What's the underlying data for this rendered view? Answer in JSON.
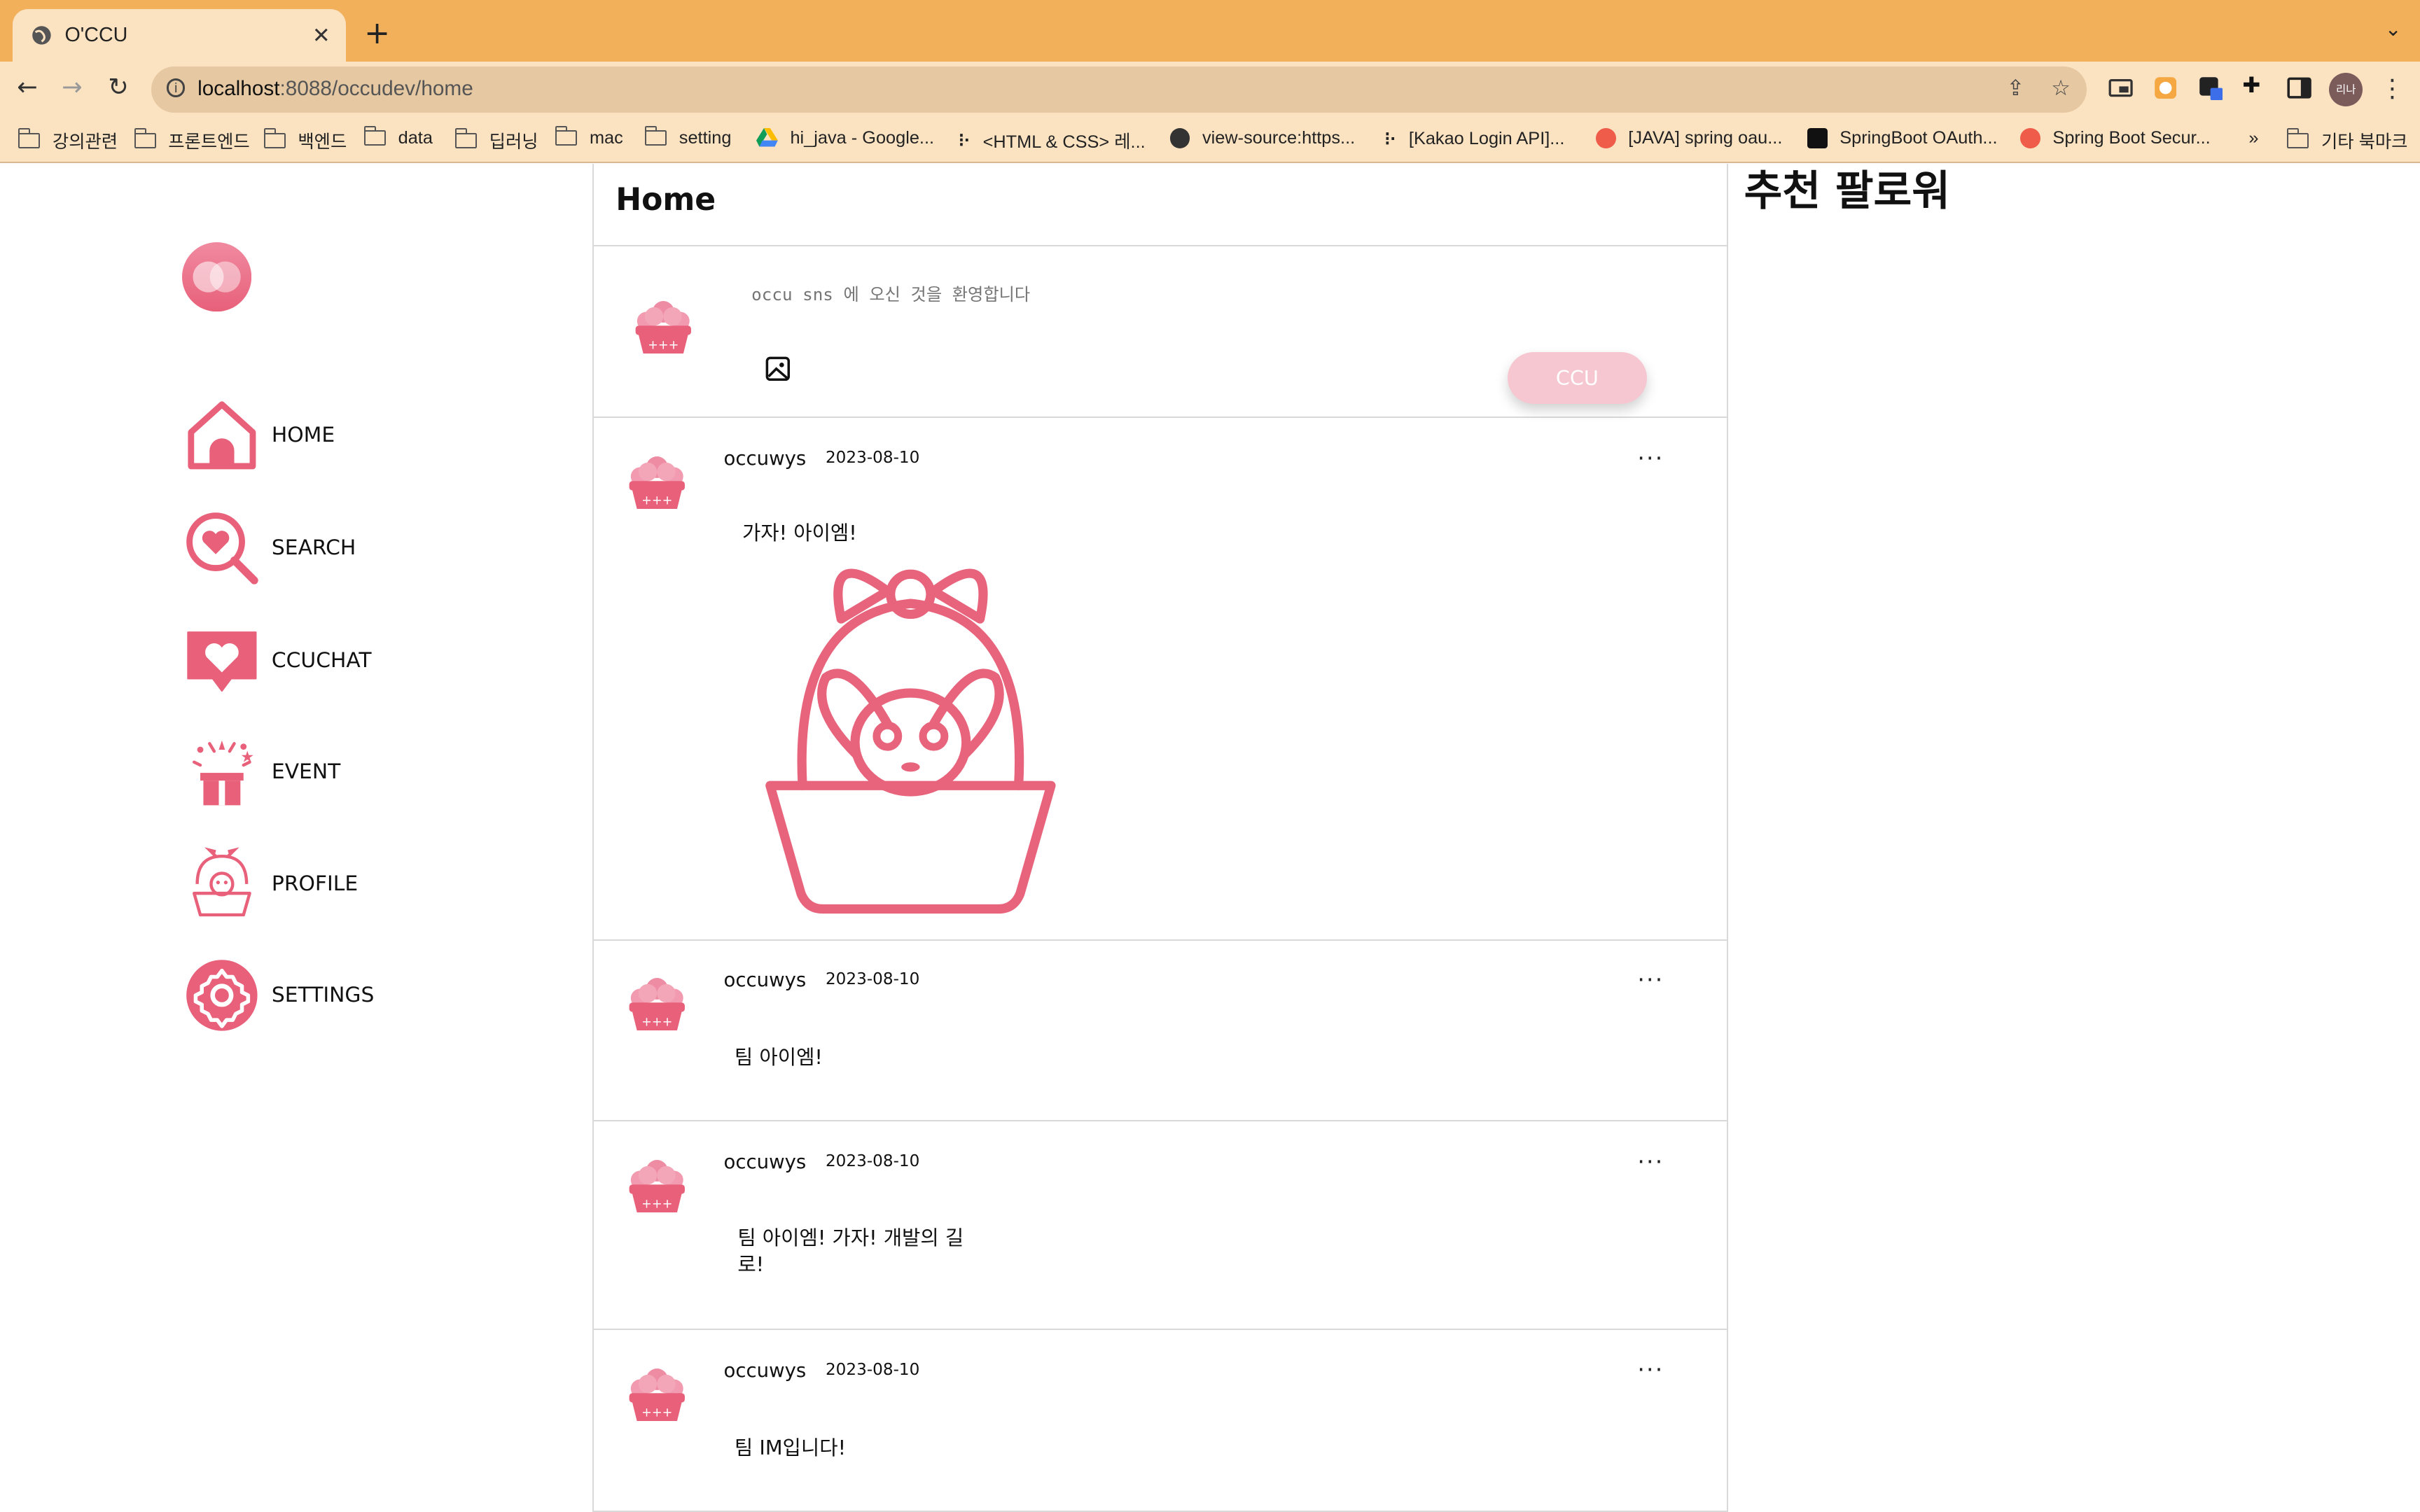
{
  "browser": {
    "tab_title": "O'CCU",
    "url_host": "localhost",
    "url_path": ":8088/occudev/home",
    "profile_initials": "리나",
    "bookmarks": [
      {
        "label": "강의관련",
        "kind": "folder"
      },
      {
        "label": "프론트엔드",
        "kind": "folder"
      },
      {
        "label": "백엔드",
        "kind": "folder"
      },
      {
        "label": "data",
        "kind": "folder"
      },
      {
        "label": "딥러닝",
        "kind": "folder"
      },
      {
        "label": "mac",
        "kind": "folder"
      },
      {
        "label": "setting",
        "kind": "folder"
      },
      {
        "label": "hi_java - Google...",
        "kind": "drive-icon"
      },
      {
        "label": "<HTML & CSS> 레...",
        "kind": "dots-icon"
      },
      {
        "label": "view-source:https...",
        "kind": "globe-icon"
      },
      {
        "label": "[Kakao Login API]...",
        "kind": "dots-icon"
      },
      {
        "label": "[JAVA] spring oau...",
        "kind": "tistory-icon"
      },
      {
        "label": "SpringBoot OAuth...",
        "kind": "medium-icon"
      },
      {
        "label": "Spring Boot Secur...",
        "kind": "tistory-icon"
      }
    ],
    "overflow": "»",
    "other_bookmarks": "기타 북마크"
  },
  "sidebar": {
    "items": [
      {
        "label": "HOME",
        "icon": "home-icon"
      },
      {
        "label": "SEARCH",
        "icon": "search-heart-icon"
      },
      {
        "label": "CCUCHAT",
        "icon": "chat-heart-icon"
      },
      {
        "label": "EVENT",
        "icon": "gift-icon"
      },
      {
        "label": "PROFILE",
        "icon": "bunny-basket-icon"
      },
      {
        "label": "SETTINGS",
        "icon": "gear-icon"
      }
    ]
  },
  "main": {
    "title": "Home",
    "composer": {
      "placeholder": "occu sns 에 오신 것을 환영합니다",
      "submit_label": "CCU"
    },
    "posts": [
      {
        "author": "occuwys",
        "date": "2023-08-10",
        "content": "가자! 아이엠!",
        "has_image": true
      },
      {
        "author": "occuwys",
        "date": "2023-08-10",
        "content": "팀 아이엠!",
        "has_image": false
      },
      {
        "author": "occuwys",
        "date": "2023-08-10",
        "content": "팀 아이엠! 가자! 개발의 길로!",
        "has_image": false
      },
      {
        "author": "occuwys",
        "date": "2023-08-10",
        "content": "팀 IM입니다!",
        "has_image": false
      }
    ],
    "more_label": "···"
  },
  "right": {
    "title": "추천 팔로워"
  },
  "colors": {
    "accent": "#e8607a",
    "accent_light": "#f6c7d0",
    "chrome_tabstrip": "#f2b05b",
    "chrome_toolbar": "#fbe3c2"
  }
}
